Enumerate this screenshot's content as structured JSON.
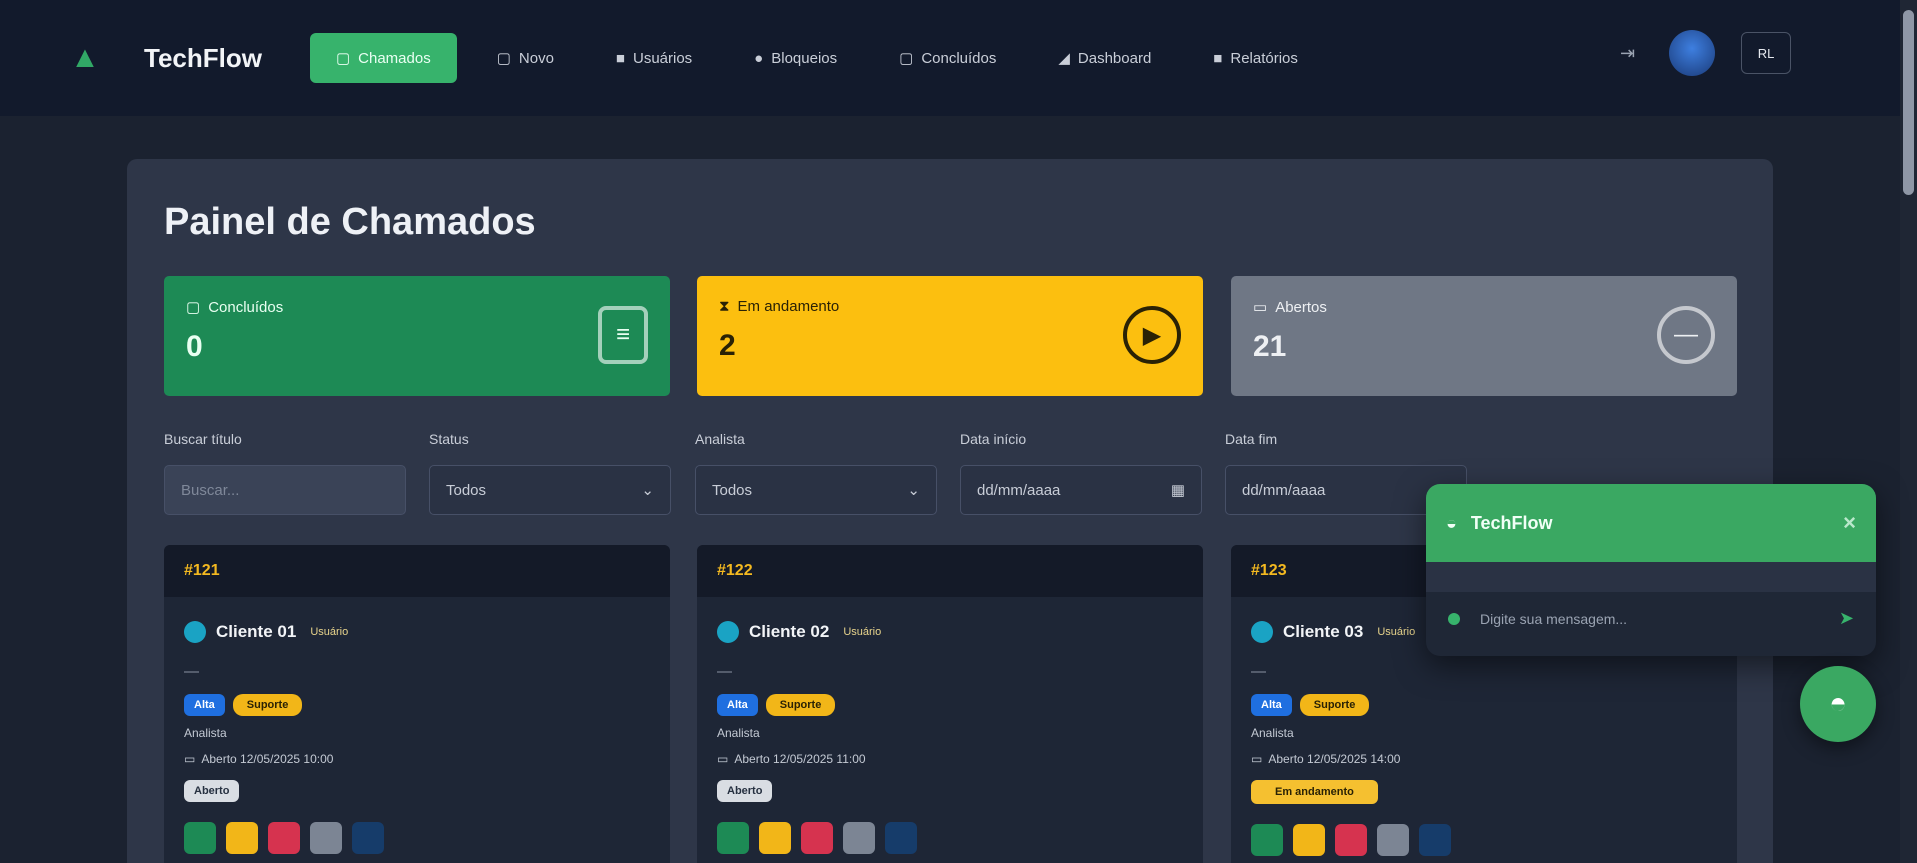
{
  "nav": {
    "brand": "TechFlow",
    "items": [
      {
        "label": "Chamados",
        "icon": "ticket-icon"
      },
      {
        "label": "Novo",
        "icon": "plus-icon"
      },
      {
        "label": "Usuários",
        "icon": "users-icon"
      },
      {
        "label": "Bloqueios",
        "icon": "block-icon"
      },
      {
        "label": "Concluídos",
        "icon": "check-icon"
      },
      {
        "label": "Dashboard",
        "icon": "chart-icon"
      },
      {
        "label": "Relatórios",
        "icon": "report-icon"
      }
    ],
    "user_initials": "RL"
  },
  "page": {
    "title": "Painel de Chamados"
  },
  "stats": [
    {
      "label": "Concluídos",
      "value": "0",
      "color": "#1d8a55"
    },
    {
      "label": "Em andamento",
      "value": "2",
      "color": "#fcbf0f"
    },
    {
      "label": "Abertos",
      "value": "21",
      "color": "#6f7785"
    }
  ],
  "filters": [
    {
      "label": "Buscar título",
      "value": "Buscar..."
    },
    {
      "label": "Status",
      "value": "Todos"
    },
    {
      "label": "Analista",
      "value": "Todos"
    },
    {
      "label": "Data início",
      "value": "dd/mm/aaaa"
    },
    {
      "label": "Data fim",
      "value": "dd/mm/aaaa"
    }
  ],
  "cards": [
    {
      "id": "#121",
      "client": "Cliente 01",
      "tag": "Usuário",
      "desc": "—",
      "priority": "Alta",
      "type": "Suporte",
      "analyst": "Analista",
      "date": "Aberto 12/05/2025 10:00",
      "status": "Aberto"
    },
    {
      "id": "#122",
      "client": "Cliente 02",
      "tag": "Usuário",
      "desc": "—",
      "priority": "Alta",
      "type": "Suporte",
      "analyst": "Analista",
      "date": "Aberto 12/05/2025 11:00",
      "status": "Aberto"
    },
    {
      "id": "#123",
      "client": "Cliente 03",
      "tag": "Usuário",
      "desc": "—",
      "priority": "Alta",
      "type": "Suporte",
      "analyst": "Analista",
      "date": "Aberto 12/05/2025 14:00",
      "status": "Em andamento"
    }
  ],
  "chat": {
    "title": "TechFlow",
    "placeholder": "Digite sua mensagem..."
  }
}
